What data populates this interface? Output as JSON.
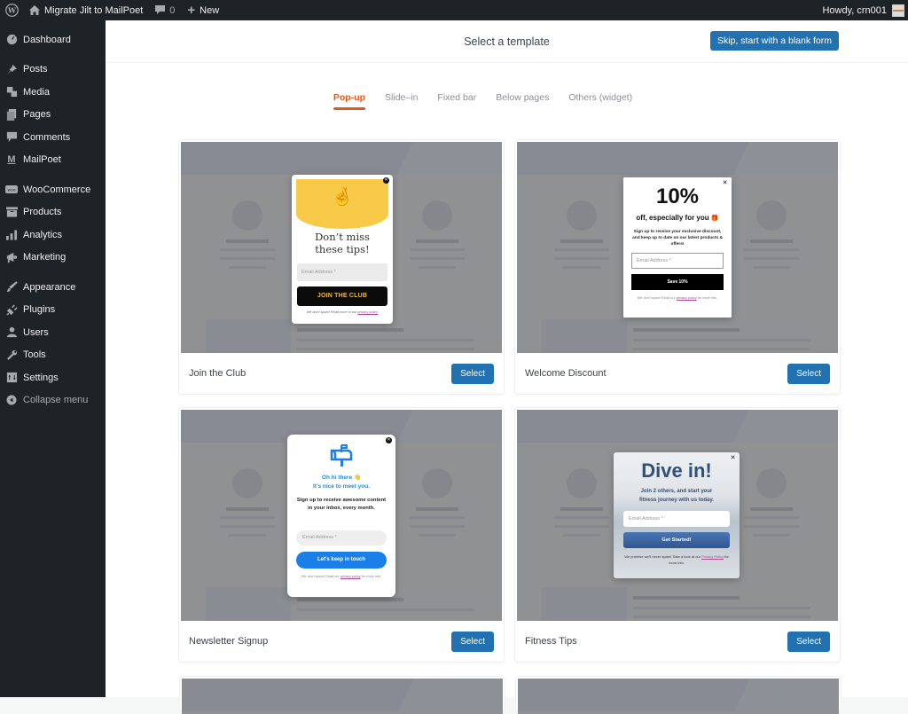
{
  "adminbar": {
    "site_name": "Migrate Jilt to MailPoet",
    "comments_count": "0",
    "new_label": "New",
    "howdy": "Howdy, crn001"
  },
  "sidebar": {
    "items": [
      {
        "label": "Dashboard",
        "icon": "dashboard-icon"
      },
      {
        "label": "Posts",
        "icon": "pin-icon"
      },
      {
        "label": "Media",
        "icon": "media-icon"
      },
      {
        "label": "Pages",
        "icon": "pages-icon"
      },
      {
        "label": "Comments",
        "icon": "comment-icon"
      },
      {
        "label": "MailPoet",
        "icon": "mailpoet-icon"
      },
      {
        "label": "WooCommerce",
        "icon": "woocommerce-icon"
      },
      {
        "label": "Products",
        "icon": "archive-icon"
      },
      {
        "label": "Analytics",
        "icon": "bar-chart-icon"
      },
      {
        "label": "Marketing",
        "icon": "megaphone-icon"
      },
      {
        "label": "Appearance",
        "icon": "paintbrush-icon"
      },
      {
        "label": "Plugins",
        "icon": "plug-icon"
      },
      {
        "label": "Users",
        "icon": "user-icon"
      },
      {
        "label": "Tools",
        "icon": "wrench-icon"
      },
      {
        "label": "Settings",
        "icon": "settings-icon"
      }
    ],
    "collapse_label": "Collapse menu"
  },
  "header": {
    "title": "Select a template",
    "skip_button": "Skip, start with a blank form"
  },
  "tabs": [
    {
      "label": "Pop-up",
      "active": true
    },
    {
      "label": "Slide–in",
      "active": false
    },
    {
      "label": "Fixed bar",
      "active": false
    },
    {
      "label": "Below pages",
      "active": false
    },
    {
      "label": "Others (widget)",
      "active": false
    }
  ],
  "select_label": "Select",
  "templates": [
    {
      "name": "Join the Club",
      "popup": {
        "headline_1": "Don’t miss",
        "headline_2": "these tips!",
        "email_placeholder": "Email Address *",
        "cta": "JOIN THE CLUB",
        "fine_print": "We don't spam! Read more in our",
        "fine_link": "privacy policy",
        "emoji": "🤞"
      }
    },
    {
      "name": "Welcome Discount",
      "popup": {
        "big": "10%",
        "sub": "off, especially for you",
        "emoji": "🎁",
        "desc": "Sign up to receive your exclusive discount, and keep up to date on our latest products & offers!",
        "email_placeholder": "Email Address *",
        "cta": "Save 10%",
        "fine_print": "We don't spam! Read our",
        "fine_link": "privacy policy",
        "fine_after": "for more info."
      }
    },
    {
      "name": "Newsletter Signup",
      "popup": {
        "hi_1": "Oh hi there 👋",
        "hi_2": "It's nice to meet you.",
        "desc": "Sign up to receive awesome content in your inbox, every month.",
        "email_placeholder": "Email Address *",
        "cta": "Let's keep in touch",
        "fine_print": "We don't spam! Read our",
        "fine_link": "privacy policy",
        "fine_after": "for more info."
      }
    },
    {
      "name": "Fitness Tips",
      "popup": {
        "big": "Dive in!",
        "desc_1": "Join 2 others, and start your",
        "desc_2": "fitness journey with us today.",
        "email_placeholder": "Email Address *",
        "cta": "Get Started!",
        "fine_print": "We promise we'll never spam! Take a look at our",
        "fine_link": "Privacy Policy",
        "fine_after": "for more info."
      }
    }
  ],
  "colors": {
    "accent": "#2271b1",
    "tab_active": "#e0591d",
    "sidebar_bg": "#1d2327"
  }
}
